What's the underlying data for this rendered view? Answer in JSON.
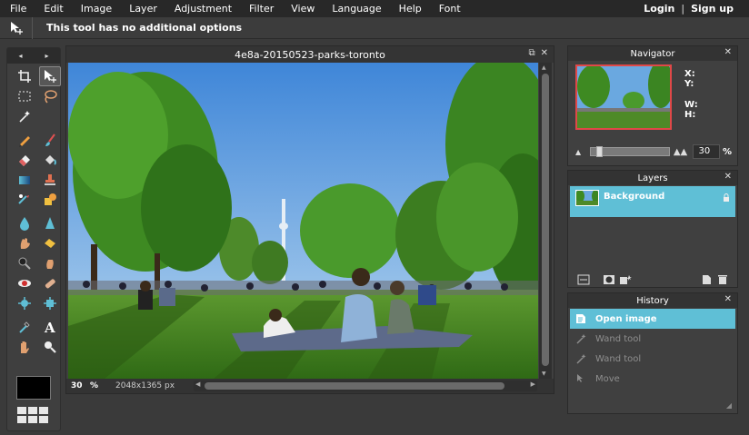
{
  "menu": {
    "items": [
      "File",
      "Edit",
      "Image",
      "Layer",
      "Adjustment",
      "Filter",
      "View",
      "Language",
      "Help",
      "Font"
    ],
    "login": "Login",
    "separator": "|",
    "signup": "Sign up"
  },
  "options_bar": {
    "tool_icon": "move-tool-icon",
    "message": "This tool has no additional options"
  },
  "tools": {
    "arrow_left": "◂",
    "arrow_right": "▸",
    "items": [
      "crop",
      "move",
      "marquee",
      "lasso",
      "wand",
      "pencil",
      "brush",
      "eraser",
      "bucket",
      "gradient",
      "clone-stamp",
      "color-replace",
      "drawing",
      "blur",
      "sharpen",
      "smudge",
      "sponge",
      "dodge",
      "burn",
      "red-eye",
      "spot-heal",
      "bloat",
      "pinch",
      "color-picker",
      "type",
      "hand",
      "zoom"
    ],
    "selected": "move",
    "foreground_color": "#000000"
  },
  "canvas": {
    "title": "4e8a-20150523-parks-toronto",
    "zoom": "30",
    "zoom_unit": "%",
    "dimensions": "2048x1365 px",
    "restore_btn": "⧉",
    "close_btn": "✕"
  },
  "navigator": {
    "title": "Navigator",
    "close": "✕",
    "x_label": "X:",
    "y_label": "Y:",
    "w_label": "W:",
    "h_label": "H:",
    "zoom_value": "30",
    "zoom_unit": "%"
  },
  "layers": {
    "title": "Layers",
    "close": "✕",
    "items": [
      {
        "name": "Background",
        "locked": true
      }
    ]
  },
  "history": {
    "title": "History",
    "close": "✕",
    "items": [
      {
        "label": "Open image",
        "state": "active"
      },
      {
        "label": "Wand tool",
        "state": "dim"
      },
      {
        "label": "Wand tool",
        "state": "dim"
      },
      {
        "label": "Move",
        "state": "dim"
      }
    ]
  },
  "colors": {
    "accent": "#5fbfd6",
    "menubar": "#282828",
    "panel": "#404040"
  }
}
